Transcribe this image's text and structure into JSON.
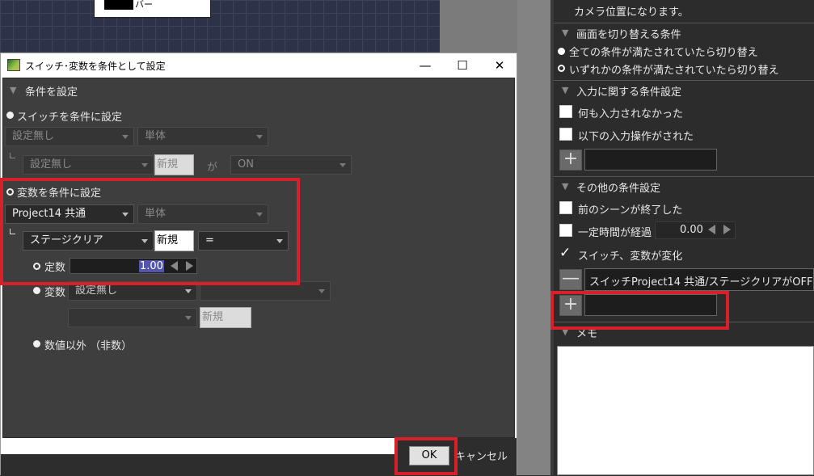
{
  "background": {
    "node_label": "バー"
  },
  "dialog": {
    "title": "スイッチ･変数を条件として設定",
    "minimize": "—",
    "maximize": "☐",
    "close": "✕",
    "section_header": "条件を設定",
    "switch_option": "スイッチを条件に設定",
    "switch_combo1": "設定無し",
    "switch_combo2": "単体",
    "switch_sub_combo": "設定無し",
    "switch_new": "新規",
    "ga": "が",
    "switch_state": "ON",
    "variable_option": "変数を条件に設定",
    "var_project": "Project14 共通",
    "var_scope": "単体",
    "var_name": "ステージクリア",
    "var_new": "新規",
    "var_operator": "=",
    "const_label": "定数",
    "const_value": "1.00",
    "var_label": "変数",
    "var_compare_combo": "設定無し",
    "var_compare_combo2": "",
    "var_compare_sub": "",
    "var_compare_new": "新規",
    "non_numeric_label": "数値以外 （非数）",
    "ok": "OK",
    "cancel": "キャンセル"
  },
  "right_panel": {
    "top_text": "カメラ位置になります。",
    "switch_scene_header": "画面を切り替える条件",
    "all_conditions": "全ての条件が満たされていたら切り替え",
    "any_condition": "いずれかの条件が満たされていたら切り替え",
    "input_header": "入力に関する条件設定",
    "no_input": "何も入力されなかった",
    "following_input": "以下の入力操作がされた",
    "other_header": "その他の条件設定",
    "prev_scene_ended": "前のシーンが終了した",
    "time_elapsed": "一定時間が経過",
    "time_value": "0.00",
    "switch_var_changed": "スイッチ、変数が変化",
    "condition_entry": "スイッチProject14 共通/ステージクリアがOFF",
    "memo_header": "メモ",
    "plus": "+",
    "minus": "—"
  },
  "colors": {
    "highlight": "#d9202a",
    "dialog_bg": "#3e3e3e",
    "panel_bg": "#2c2c2c"
  }
}
